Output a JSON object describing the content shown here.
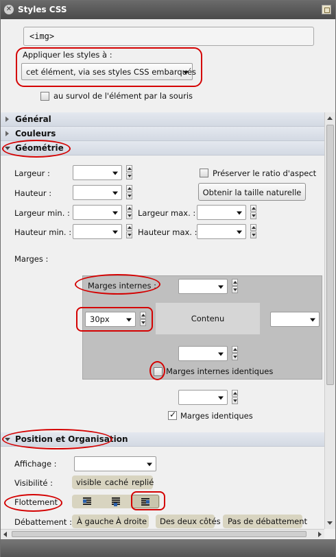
{
  "window": {
    "title": "Styles CSS"
  },
  "tag": "<img>",
  "apply": {
    "label": "Appliquer les styles à :",
    "selected": "cet élément, via ses styles CSS embarqués",
    "hover_label": "au survol de l'élément par la souris"
  },
  "sections": {
    "general": "Général",
    "colors": "Couleurs",
    "geometry": "Géométrie",
    "position": "Position et Organisation"
  },
  "geometry": {
    "width_label": "Largeur :",
    "height_label": "Hauteur :",
    "min_width_label": "Largeur min. :",
    "max_width_label": "Largeur max. :",
    "min_height_label": "Hauteur min. :",
    "max_height_label": "Hauteur max. :",
    "keep_ratio_label": "Préserver le ratio d'aspect",
    "natural_size_button": "Obtenir la taille naturelle",
    "margins_label": "Marges :",
    "inner_margins_label": "Marges internes :",
    "left_padding_value": "30px",
    "content_label": "Contenu",
    "identical_inner_label": "Marges internes identiques",
    "identical_margins_label": "Marges identiques"
  },
  "position": {
    "display_label": "Affichage :",
    "visibility_label": "Visibilité :",
    "visibility_options": [
      "visible",
      "caché",
      "replié"
    ],
    "float_label": "Flottement :",
    "clear_label": "Débattement :",
    "clear_options": [
      "À gauche",
      "À droite",
      "Des deux côtés",
      "Pas de débattement"
    ]
  },
  "colors": {
    "highlight": "#d40000",
    "section_bg": "#dde2ea"
  }
}
